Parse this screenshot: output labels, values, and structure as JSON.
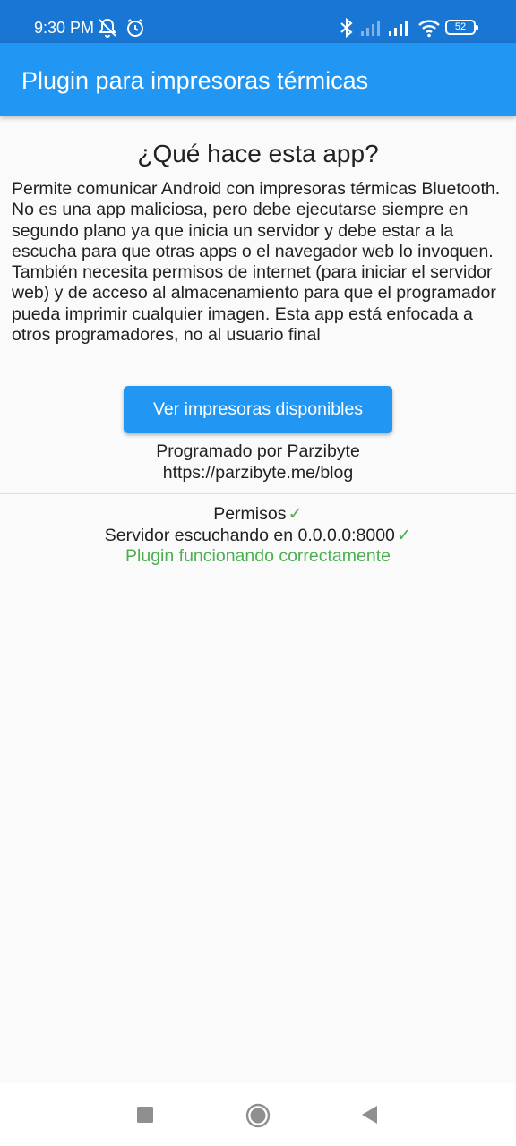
{
  "status_bar": {
    "time": "9:30 PM",
    "battery": "52",
    "icons": [
      "bell-muted-icon",
      "alarm-icon",
      "bluetooth-icon",
      "signal-empty-icon",
      "signal-icon",
      "wifi-icon",
      "battery-icon"
    ]
  },
  "app_bar": {
    "title": "Plugin para impresoras térmicas"
  },
  "main": {
    "heading": "¿Qué hace esta app?",
    "description": "Permite comunicar Android con impresoras térmicas Bluetooth. No es una app maliciosa, pero debe ejecutarse siempre en segundo plano ya que inicia un servidor y debe estar a la escucha para que otras apps o el navegador web lo invoquen. También necesita permisos de internet (para iniciar el servidor web) y de acceso al almacenamiento para que el programador pueda imprimir cualquier imagen. Esta app está enfocada a otros programadores, no al usuario final",
    "button_label": "Ver impresoras disponibles",
    "credits_author": "Programado por Parzibyte",
    "credits_url": "https://parzibyte.me/blog"
  },
  "status": {
    "permissions_label": "Permisos",
    "server_label": "Servidor escuchando en 0.0.0.0:8000",
    "check_mark": "✓",
    "plugin_ok": "Plugin funcionando correctamente"
  },
  "colors": {
    "app_bar": "#2196f3",
    "status_bar": "#1976d2",
    "success": "#4caf50",
    "background": "#fafafa"
  },
  "nav_bar": {
    "icons": [
      "recents-icon",
      "home-icon",
      "back-icon"
    ]
  }
}
